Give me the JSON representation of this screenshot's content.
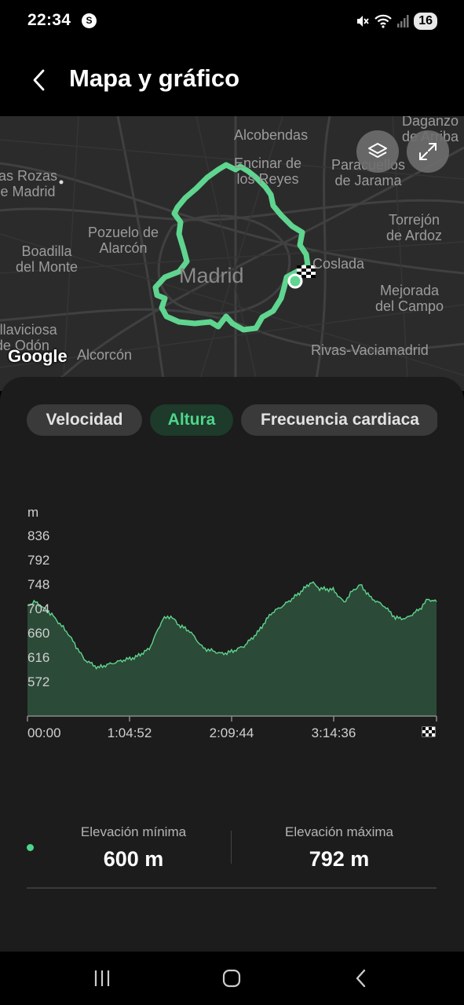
{
  "status_bar": {
    "time": "22:34",
    "app_icon": "shazam-icon",
    "icons": [
      "mute-icon",
      "wifi-icon",
      "signal-icon"
    ],
    "battery": "16"
  },
  "header": {
    "back_icon": "chevron-left-icon",
    "title": "Mapa y gráfico"
  },
  "map": {
    "labels": {
      "alcobendas": "Alcobendas",
      "dagan": "Daganzo\nde Arriba",
      "encinar": "Encinar de\nlos Reyes",
      "paracuellos": "Paracuellos\nde Jarama",
      "rozas": "Las Rozas\nde Madrid",
      "torrejon": "Torrejón\nde Ardoz",
      "pozuelo": "Pozuelo de\nAlarcón",
      "boadilla": "Boadilla\ndel Monte",
      "madrid": "Madrid",
      "coslada": "Coslada",
      "mejorada": "Mejorada\ndel Campo",
      "villaviciosa": "Villaviciosa\nde Odón",
      "alcorcon": "Alcorcón",
      "rivas": "Rivas-Vaciamadrid"
    },
    "attribution": "Google",
    "buttons": {
      "layers": "layers-icon",
      "expand": "expand-icon"
    },
    "route_color": "#5fd58f"
  },
  "tabs": [
    {
      "label": "Velocidad",
      "active": false
    },
    {
      "label": "Altura",
      "active": true
    },
    {
      "label": "Frecuencia cardiaca",
      "active": false
    }
  ],
  "chart_data": {
    "type": "area",
    "ylabel": "m",
    "y_ticks": [
      836,
      792,
      748,
      704,
      660,
      616,
      572
    ],
    "x_ticks": [
      "00:00",
      "1:04:52",
      "2:09:44",
      "3:14:36"
    ],
    "finish_icon": "checkered-flag-icon",
    "x_range_seconds": [
      0,
      15120
    ],
    "ylim": [
      540,
      840
    ],
    "fill_color": "#2b4a37",
    "line_color": "#5fd58f",
    "series": [
      {
        "x": [
          0,
          300,
          900,
          1500,
          2100,
          2600,
          3000,
          3500,
          4000,
          4500,
          5000,
          5300,
          5600,
          6000,
          6500,
          6800,
          7200,
          7600,
          8000,
          8500,
          9000,
          9500,
          10000,
          10500,
          10800,
          11300,
          11700,
          12000,
          12300,
          12700,
          13200,
          13600,
          14000,
          14500,
          14800,
          15120
        ],
        "y": [
          710,
          716,
          693,
          659,
          612,
          597,
          603,
          610,
          616,
          631,
          685,
          690,
          674,
          663,
          632,
          628,
          622,
          627,
          636,
          660,
          695,
          711,
          730,
          752,
          740,
          738,
          715,
          735,
          747,
          723,
          708,
          687,
          686,
          703,
          721,
          716
        ]
      }
    ]
  },
  "stats": {
    "min_label": "Elevación mínima",
    "min_value": "600 m",
    "max_label": "Elevación máxima",
    "max_value": "792 m"
  },
  "nav_bar": {
    "recents": "recents-icon",
    "home": "home-icon",
    "back": "back-icon"
  }
}
